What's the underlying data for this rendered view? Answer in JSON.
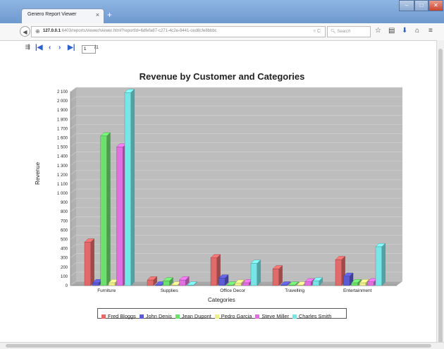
{
  "browser": {
    "tab_title": "Genero Report Viewer",
    "tab_close": "×",
    "new_tab": "+",
    "url_host": "127.0.0.1",
    "url_rest": ":6403/reports/viewer/viewer.html?reportId=6dfefa87-c271-4c2e-8441-ced8cfe8bbbc",
    "url_dropdown": "▿ C",
    "search_placeholder": "Search"
  },
  "viewer": {
    "page_value": "1",
    "page_total": "/1"
  },
  "chart_data": {
    "type": "bar",
    "title": "Revenue by Customer and Categories",
    "xlabel": "Categories",
    "ylabel": "Revenue",
    "ylim": [
      0,
      2100
    ],
    "ytick_step": 100,
    "ytick_labels": [
      "0",
      "100",
      "200",
      "300",
      "400",
      "500",
      "600",
      "700",
      "800",
      "900",
      "1 000",
      "1 100",
      "1 200",
      "1 300",
      "1 400",
      "1 500",
      "1 600",
      "1 700",
      "1 800",
      "1 900",
      "2 000",
      "2 100"
    ],
    "categories": [
      "Furniture",
      "Supplies",
      "Office Decor",
      "Travelling",
      "Entertainment"
    ],
    "series": [
      {
        "name": "Fred Bloggs",
        "color": "#e26a6a",
        "values": [
          470,
          60,
          300,
          180,
          280
        ]
      },
      {
        "name": "John Denis",
        "color": "#5b5bd6",
        "values": [
          30,
          5,
          80,
          5,
          100
        ]
      },
      {
        "name": "Jean Dupont",
        "color": "#6ee06e",
        "values": [
          1620,
          50,
          5,
          5,
          30
        ]
      },
      {
        "name": "Pedro Garcia",
        "color": "#f0f08a",
        "values": [
          30,
          5,
          25,
          5,
          30
        ]
      },
      {
        "name": "Steve Miller",
        "color": "#e070e0",
        "values": [
          1500,
          60,
          30,
          40,
          40
        ]
      },
      {
        "name": "Charles Smith",
        "color": "#76e6e6",
        "values": [
          2090,
          5,
          240,
          50,
          420
        ]
      }
    ],
    "grid": true,
    "legend_position": "bottom"
  }
}
